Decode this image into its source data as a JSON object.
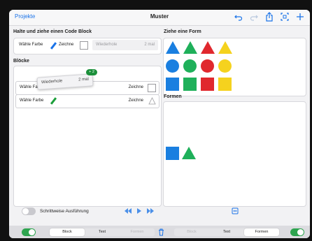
{
  "header": {
    "back_label": "Projekte",
    "title": "Muster",
    "icons": [
      "undo-icon",
      "redo-icon",
      "share-icon",
      "fullscreen-icon",
      "add-icon"
    ]
  },
  "left": {
    "code_block_title": "Halte und ziehe einen Code Block",
    "palette": {
      "choose_color": "Wähle Farbe",
      "draw": "Zeichne",
      "repeat": "Wiederhole",
      "times": "2 mal"
    },
    "blocks_title": "Blöcke",
    "drag_badge": "+ 2",
    "drag": {
      "repeat": "Wiederhole",
      "times": "2 mal"
    },
    "rows": [
      {
        "choose_color": "Wähle Farbe",
        "draw": "Zeichne"
      },
      {
        "choose_color": "Wähle Farbe",
        "draw": "Zeichne"
      }
    ],
    "step_toggle_label": "Schrittweise Ausführung"
  },
  "right": {
    "shapes_title": "Ziehe eine Form",
    "forms_title": "Formen"
  },
  "bottom": {
    "seg_left": [
      "Block",
      "Text",
      "Formen"
    ],
    "seg_right": [
      "Block",
      "Text",
      "Formen"
    ]
  },
  "colors": {
    "blue": "#1a7fe0",
    "green": "#1fb05a",
    "red": "#e0282e",
    "yellow": "#f5d21e",
    "accent": "#1a73e8",
    "toggle_on": "#2ea44f"
  }
}
